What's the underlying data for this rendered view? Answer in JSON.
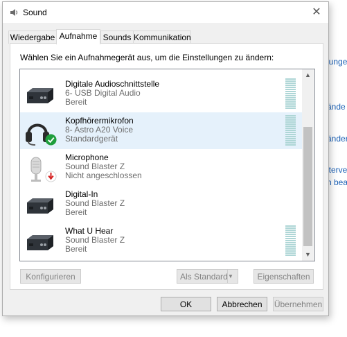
{
  "window": {
    "title": "Sound",
    "close_label": "✕"
  },
  "tabs": [
    {
      "label": "Wiedergabe"
    },
    {
      "label": "Aufnahme"
    },
    {
      "label": "Sounds"
    },
    {
      "label": "Kommunikation"
    }
  ],
  "instruction": "Wählen Sie ein Aufnahmegerät aus, um die Einstellungen zu ändern:",
  "devices": [
    {
      "name": "Digitale Audioschnittstelle",
      "description": "6- USB Digital Audio",
      "status": "Bereit",
      "icon": "line-in-box-icon"
    },
    {
      "name": "Kopfhörermikrofon",
      "description": "8- Astro A20 Voice",
      "status": "Standardgerät",
      "icon": "headset-icon",
      "badge": "default-check-icon",
      "selected": true
    },
    {
      "name": "Microphone",
      "description": "Sound Blaster Z",
      "status": "Nicht angeschlossen",
      "icon": "microphone-icon",
      "badge": "unplugged-arrow-icon"
    },
    {
      "name": "Digital-In",
      "description": "Sound Blaster Z",
      "status": "Bereit",
      "icon": "line-in-box-icon"
    },
    {
      "name": "What U Hear",
      "description": "Sound Blaster Z",
      "status": "Bereit",
      "icon": "line-in-box-icon"
    }
  ],
  "buttons": {
    "configure": "Konfigurieren",
    "set_default": "Als Standard",
    "properties": "Eigenschaften",
    "ok": "OK",
    "cancel": "Abbrechen",
    "apply": "Übernehmen"
  },
  "background_links": [
    "lungen",
    "ände",
    "änder",
    "ltervei",
    "n bea"
  ],
  "colors": {
    "selection": "#e5f1fb",
    "meter": "#aed6d6",
    "check_badge": "#1f9e3c",
    "unplugged_badge": "#d62828"
  }
}
